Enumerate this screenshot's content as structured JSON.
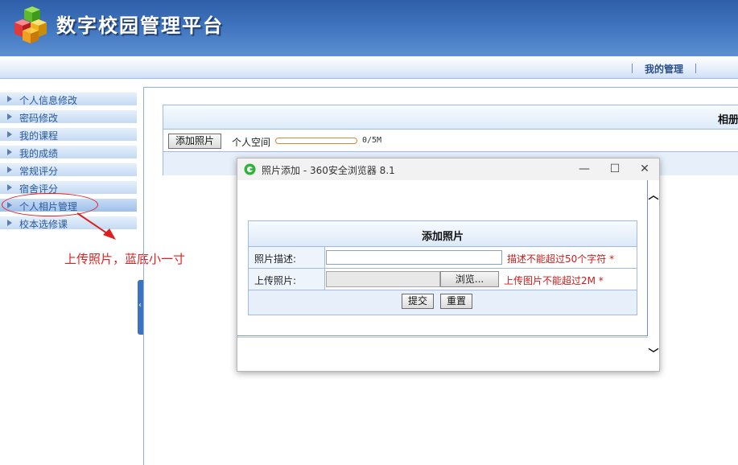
{
  "header": {
    "title": "数字校园管理平台",
    "logo_icon": "colored-cubes-logo"
  },
  "navbar": {
    "link": "我的管理"
  },
  "sidebar": {
    "items": [
      {
        "label": "个人信息修改"
      },
      {
        "label": "密码修改"
      },
      {
        "label": "我的课程"
      },
      {
        "label": "我的成绩"
      },
      {
        "label": "常规评分"
      },
      {
        "label": "宿舍评分"
      },
      {
        "label": "个人相片管理"
      },
      {
        "label": "校本选修课"
      }
    ]
  },
  "annotation": {
    "text": "上传照片，蓝底小一寸",
    "color": "#e02020"
  },
  "content": {
    "panel_title": "相册",
    "add_photo_button": "添加照片",
    "space_label": "个人空间",
    "space_usage": "0/5M",
    "space_used_fraction": 0
  },
  "popup": {
    "title": "照片添加 - 360安全浏览器 8.1",
    "form_title": "添加照片",
    "desc_label": "照片描述:",
    "desc_value": "",
    "desc_hint": "描述不能超过50个字符 *",
    "upload_label": "上传照片:",
    "browse_button": "浏览...",
    "upload_hint": "上传图片不能超过2M *",
    "submit_button": "提交",
    "reset_button": "重置"
  }
}
